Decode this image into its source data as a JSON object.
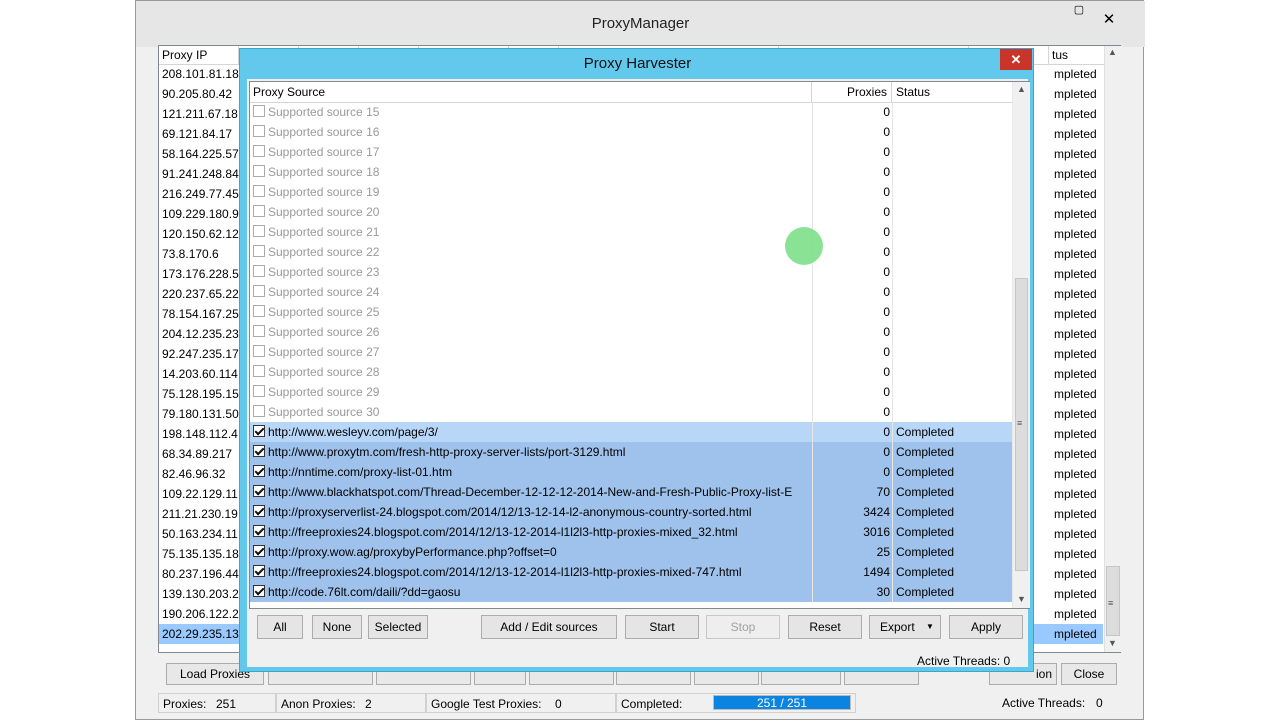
{
  "main": {
    "title": "ProxyManager",
    "close_glyph": "✕",
    "columns": {
      "proxy_ip": "Proxy IP",
      "status": "tus"
    },
    "rows": [
      {
        "ip": "208.101.81.18",
        "status": "mpleted"
      },
      {
        "ip": "90.205.80.42",
        "status": "mpleted"
      },
      {
        "ip": "121.211.67.18",
        "status": "mpleted"
      },
      {
        "ip": "69.121.84.17",
        "status": "mpleted"
      },
      {
        "ip": "58.164.225.57",
        "status": "mpleted"
      },
      {
        "ip": "91.241.248.84",
        "status": "mpleted"
      },
      {
        "ip": "216.249.77.45",
        "status": "mpleted"
      },
      {
        "ip": "109.229.180.9",
        "status": "mpleted"
      },
      {
        "ip": "120.150.62.12",
        "status": "mpleted"
      },
      {
        "ip": "73.8.170.6",
        "status": "mpleted"
      },
      {
        "ip": "173.176.228.5",
        "status": "mpleted"
      },
      {
        "ip": "220.237.65.22",
        "status": "mpleted"
      },
      {
        "ip": "78.154.167.25",
        "status": "mpleted"
      },
      {
        "ip": "204.12.235.23",
        "status": "mpleted"
      },
      {
        "ip": "92.247.235.17",
        "status": "mpleted"
      },
      {
        "ip": "14.203.60.114",
        "status": "mpleted"
      },
      {
        "ip": "75.128.195.15",
        "status": "mpleted"
      },
      {
        "ip": "79.180.131.50",
        "status": "mpleted"
      },
      {
        "ip": "198.148.112.4",
        "status": "mpleted"
      },
      {
        "ip": "68.34.89.217",
        "status": "mpleted"
      },
      {
        "ip": "82.46.96.32",
        "status": "mpleted"
      },
      {
        "ip": "109.22.129.11",
        "status": "mpleted"
      },
      {
        "ip": "211.21.230.19",
        "status": "mpleted"
      },
      {
        "ip": "50.163.234.11",
        "status": "mpleted"
      },
      {
        "ip": "75.135.135.18",
        "status": "mpleted"
      },
      {
        "ip": "80.237.196.44",
        "status": "mpleted"
      },
      {
        "ip": "139.130.203.2",
        "status": "mpleted"
      },
      {
        "ip": "190.206.122.2",
        "status": "mpleted"
      },
      {
        "ip": "202.29.235.13",
        "status": "mpleted"
      }
    ],
    "buttons": {
      "load_proxies": "Load Proxies",
      "ion": "ion",
      "close": "Close"
    },
    "statusbar": {
      "proxies_label": "Proxies:",
      "proxies_value": "251",
      "anon_label": "Anon Proxies:",
      "anon_value": "2",
      "google_label": "Google Test Proxies:",
      "google_value": "0",
      "completed_label": "Completed:",
      "completed_progress": "251 / 251",
      "completed_fraction": 1.0,
      "threads_label": "Active Threads:",
      "threads_value": "0"
    }
  },
  "harvester": {
    "title": "Proxy Harvester",
    "close_glyph": "✕",
    "columns": {
      "source": "Proxy Source",
      "proxies": "Proxies",
      "status": "Status"
    },
    "rows": [
      {
        "checked": false,
        "source": "Supported source 15",
        "proxies": "0",
        "status": ""
      },
      {
        "checked": false,
        "source": "Supported source 16",
        "proxies": "0",
        "status": ""
      },
      {
        "checked": false,
        "source": "Supported source 17",
        "proxies": "0",
        "status": ""
      },
      {
        "checked": false,
        "source": "Supported source 18",
        "proxies": "0",
        "status": ""
      },
      {
        "checked": false,
        "source": "Supported source 19",
        "proxies": "0",
        "status": ""
      },
      {
        "checked": false,
        "source": "Supported source 20",
        "proxies": "0",
        "status": ""
      },
      {
        "checked": false,
        "source": "Supported source 21",
        "proxies": "0",
        "status": ""
      },
      {
        "checked": false,
        "source": "Supported source 22",
        "proxies": "0",
        "status": ""
      },
      {
        "checked": false,
        "source": "Supported source 23",
        "proxies": "0",
        "status": ""
      },
      {
        "checked": false,
        "source": "Supported source 24",
        "proxies": "0",
        "status": ""
      },
      {
        "checked": false,
        "source": "Supported source 25",
        "proxies": "0",
        "status": ""
      },
      {
        "checked": false,
        "source": "Supported source 26",
        "proxies": "0",
        "status": ""
      },
      {
        "checked": false,
        "source": "Supported source 27",
        "proxies": "0",
        "status": ""
      },
      {
        "checked": false,
        "source": "Supported source 28",
        "proxies": "0",
        "status": ""
      },
      {
        "checked": false,
        "source": "Supported source 29",
        "proxies": "0",
        "status": ""
      },
      {
        "checked": false,
        "source": "Supported source 30",
        "proxies": "0",
        "status": ""
      },
      {
        "checked": true,
        "source": "http://www.wesleyv.com/page/3/",
        "proxies": "0",
        "status": "Completed"
      },
      {
        "checked": true,
        "source": "http://www.proxytm.com/fresh-http-proxy-server-lists/port-3129.html",
        "proxies": "0",
        "status": "Completed"
      },
      {
        "checked": true,
        "source": "http://nntime.com/proxy-list-01.htm",
        "proxies": "0",
        "status": "Completed"
      },
      {
        "checked": true,
        "source": "http://www.blackhatspot.com/Thread-December-12-12-12-2014-New-and-Fresh-Public-Proxy-list-E",
        "proxies": "70",
        "status": "Completed"
      },
      {
        "checked": true,
        "source": "http://proxyserverlist-24.blogspot.com/2014/12/13-12-14-l2-anonymous-country-sorted.html",
        "proxies": "3424",
        "status": "Completed"
      },
      {
        "checked": true,
        "source": "http://freeproxies24.blogspot.com/2014/12/13-12-2014-l1l2l3-http-proxies-mixed_32.html",
        "proxies": "3016",
        "status": "Completed"
      },
      {
        "checked": true,
        "source": "http://proxy.wow.ag/proxybyPerformance.php?offset=0",
        "proxies": "25",
        "status": "Completed"
      },
      {
        "checked": true,
        "source": "http://freeproxies24.blogspot.com/2014/12/13-12-2014-l1l2l3-http-proxies-mixed-747.html",
        "proxies": "1494",
        "status": "Completed"
      },
      {
        "checked": true,
        "source": "http://code.76lt.com/daili/?dd=gaosu",
        "proxies": "30",
        "status": "Completed"
      }
    ],
    "buttons": {
      "all": "All",
      "none": "None",
      "selected": "Selected",
      "add_edit": "Add / Edit sources",
      "start": "Start",
      "stop": "Stop",
      "reset": "Reset",
      "export": "Export",
      "apply": "Apply"
    },
    "active_threads": "Active Threads: 0"
  }
}
